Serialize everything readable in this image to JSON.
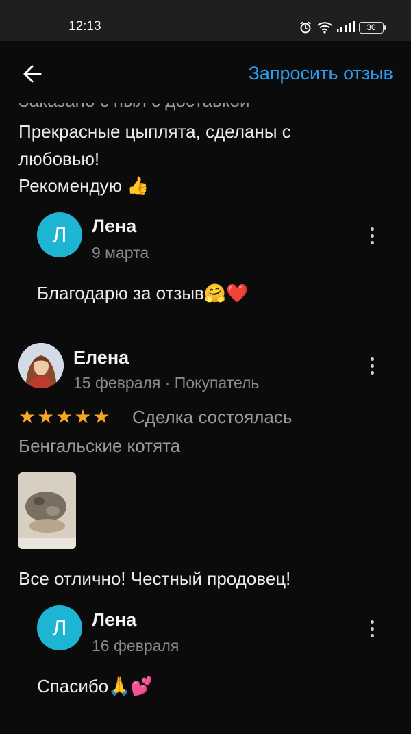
{
  "status_bar": {
    "time": "12:13",
    "battery": "30"
  },
  "header": {
    "request_review_label": "Запросить отзыв"
  },
  "review1": {
    "partial_top_text": "Заказано с пыл с доставкой",
    "text_line1": "Прекрасные цыплята, сделаны с",
    "text_line2": "любовью!",
    "text_line3": "Рекомендую 👍",
    "reply": {
      "avatar_letter": "Л",
      "name": "Лена",
      "date": "9 марта",
      "text": "Благодарю за отзыв🤗❤️"
    }
  },
  "review2": {
    "name": "Елена",
    "meta": "15 февраля · Покупатель",
    "rating": 5,
    "status": "Сделка состоялась",
    "product": "Бенгальские котята",
    "text": "Все отлично! Честный продовец!",
    "reply": {
      "avatar_letter": "Л",
      "name": "Лена",
      "date": "16 февраля",
      "text": "Спасибо🙏💕"
    }
  },
  "colors": {
    "accent": "#2c9cf0",
    "star": "#f7a823",
    "avatar_bg": "#1eb4d4"
  }
}
